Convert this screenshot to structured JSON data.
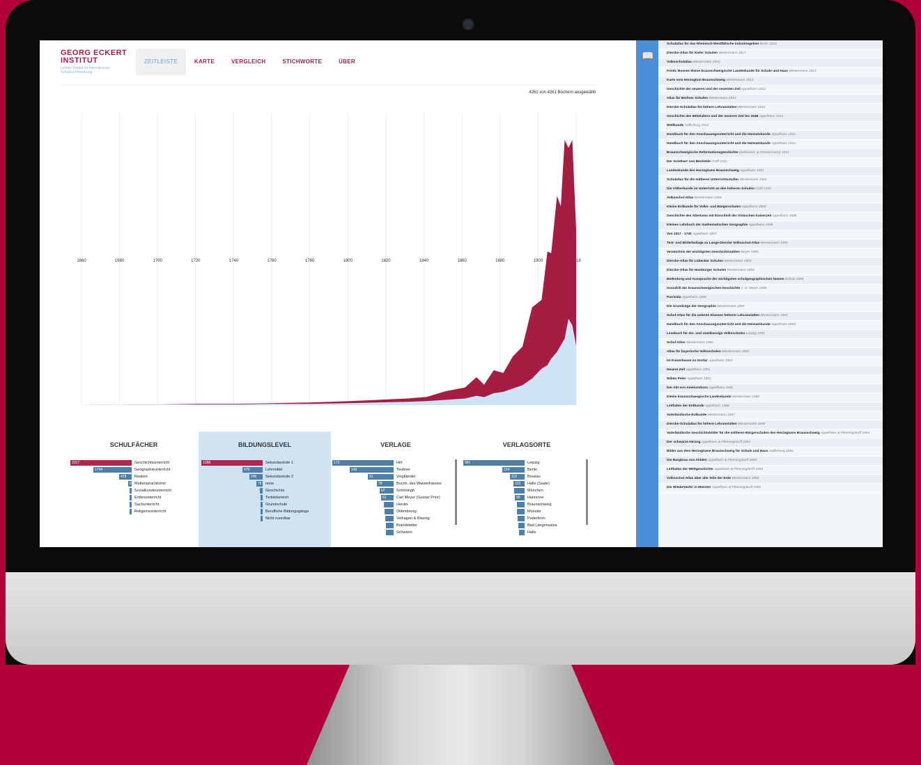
{
  "logo": {
    "line1": "GEORG ECKERT",
    "line2": "INSTITUT",
    "sub": "Leibniz-Institut für internationale Schulbuchforschung"
  },
  "nav": [
    {
      "label": "ZEITLEISTE",
      "active": true
    },
    {
      "label": "KARTE"
    },
    {
      "label": "VERGLEICH"
    },
    {
      "label": "STICHWORTE"
    },
    {
      "label": "ÜBER"
    }
  ],
  "count_text": "4261 von 4261 Büchern ausgewählt",
  "chart_data": {
    "type": "area",
    "x_ticks": [
      "1660",
      "1680",
      "1700",
      "1720",
      "1740",
      "1760",
      "1780",
      "1800",
      "1820",
      "1840",
      "1860",
      "1880",
      "1900",
      "1918"
    ],
    "colors": {
      "selected": "#a61d44",
      "total": "#cde4f5"
    },
    "series": [
      {
        "x": [
          1660,
          1700,
          1720,
          1740,
          1760,
          1780,
          1800,
          1815,
          1830,
          1840,
          1850,
          1860,
          1866,
          1870,
          1875,
          1880,
          1885,
          1890,
          1895,
          1900,
          1903,
          1905,
          1908,
          1910,
          1912,
          1914,
          1916,
          1918
        ],
        "y": [
          0,
          1,
          2,
          2,
          3,
          4,
          6,
          8,
          10,
          14,
          20,
          30,
          40,
          35,
          50,
          55,
          70,
          100,
          140,
          180,
          220,
          260,
          300,
          340,
          380,
          440,
          380,
          300
        ]
      },
      {
        "x": [
          1660,
          1700,
          1720,
          1740,
          1760,
          1780,
          1800,
          1815,
          1830,
          1840,
          1850,
          1860,
          1866,
          1870,
          1875,
          1880,
          1885,
          1890,
          1895,
          1900,
          1903,
          1905,
          1908,
          1910,
          1912,
          1914,
          1916,
          1918
        ],
        "y": [
          0,
          1,
          1,
          1,
          2,
          2,
          3,
          4,
          5,
          6,
          8,
          10,
          14,
          12,
          18,
          20,
          25,
          30,
          40,
          55,
          60,
          70,
          80,
          90,
          100,
          130,
          120,
          90
        ]
      }
    ]
  },
  "panels": {
    "schulfaecher": {
      "title": "SCHULFÄCHER",
      "rows": [
        {
          "value": "2317",
          "label": "Geschichtsunterricht",
          "color": "red",
          "frac": 1.0
        },
        {
          "value": "1744",
          "label": "Geographieunterricht",
          "color": "blue",
          "frac": 0.62
        },
        {
          "value": "478",
          "label": "Realien",
          "color": "blue",
          "frac": 0.2
        },
        {
          "value": "62",
          "label": "Muttersprachlicher",
          "color": "blue",
          "frac": 0.06
        },
        {
          "value": "",
          "label": "Sozialkundeunterricht",
          "color": "blue",
          "frac": 0.02
        },
        {
          "value": "",
          "label": "Erdlesunterricht",
          "color": "blue",
          "frac": 0.01
        },
        {
          "value": "",
          "label": "Sachunterricht",
          "color": "blue",
          "frac": 0.01
        },
        {
          "value": "",
          "label": "Religionsunterricht",
          "color": "blue",
          "frac": 0.01
        }
      ]
    },
    "bildungslevel": {
      "title": "BILDUNGSLEVEL",
      "rows": [
        {
          "value": "1288",
          "label": "Sekundarstufe 1",
          "color": "red",
          "frac": 1.0
        },
        {
          "value": "478",
          "label": "Lehrmittel",
          "color": "blue",
          "frac": 0.33
        },
        {
          "value": "296",
          "label": "Sekundarstufe 2",
          "color": "blue",
          "frac": 0.22
        },
        {
          "value": "76",
          "label": "none",
          "color": "blue",
          "frac": 0.1
        },
        {
          "value": "",
          "label": "Geschichte",
          "color": "blue",
          "frac": 0.04
        },
        {
          "value": "",
          "label": "Tertiärbereich",
          "color": "blue",
          "frac": 0.02
        },
        {
          "value": "",
          "label": "Grundschule",
          "color": "blue",
          "frac": 0.01
        },
        {
          "value": "",
          "label": "Berufliche Bildungsgänge",
          "color": "blue",
          "frac": 0.01
        },
        {
          "value": "",
          "label": "Nicht zuordbar",
          "color": "blue",
          "frac": 0.01
        }
      ]
    },
    "verlage": {
      "title": "VERLAGE",
      "rows": [
        {
          "value": "173",
          "label": "Hirt",
          "color": "blue",
          "frac": 1.0
        },
        {
          "value": "149",
          "label": "Teubner",
          "color": "blue",
          "frac": 0.72
        },
        {
          "value": "91",
          "label": "Voigtländer",
          "color": "blue",
          "frac": 0.42
        },
        {
          "value": "78",
          "label": "Buchh. des Waisenhauses",
          "color": "blue",
          "frac": 0.27
        },
        {
          "value": "67",
          "label": "Schöningh",
          "color": "blue",
          "frac": 0.23
        },
        {
          "value": "61",
          "label": "Carl Meyer (Gustav Prior)",
          "color": "blue",
          "frac": 0.2
        },
        {
          "value": "",
          "label": "Herder",
          "color": "blue",
          "frac": 0.16
        },
        {
          "value": "",
          "label": "Oldenbourg",
          "color": "blue",
          "frac": 0.15
        },
        {
          "value": "",
          "label": "Velhagen & Klasing",
          "color": "blue",
          "frac": 0.14
        },
        {
          "value": "",
          "label": "Brandstetter",
          "color": "blue",
          "frac": 0.13
        },
        {
          "value": "",
          "label": "Schwann",
          "color": "blue",
          "frac": 0.12
        }
      ]
    },
    "verlagsorte": {
      "title": "VERLAGSORTE",
      "rows": [
        {
          "value": "981",
          "label": "Leipzig",
          "color": "blue",
          "frac": 1.0
        },
        {
          "value": "224",
          "label": "Berlin",
          "color": "blue",
          "frac": 0.36
        },
        {
          "value": "118",
          "label": "Breslau",
          "color": "blue",
          "frac": 0.24
        },
        {
          "value": "102",
          "label": "Halle (Saale)",
          "color": "blue",
          "frac": 0.18
        },
        {
          "value": "",
          "label": "München",
          "color": "blue",
          "frac": 0.17
        },
        {
          "value": "95",
          "label": "Hannover",
          "color": "blue",
          "frac": 0.16
        },
        {
          "value": "",
          "label": "Braunschweig",
          "color": "blue",
          "frac": 0.13
        },
        {
          "value": "",
          "label": "Münster",
          "color": "blue",
          "frac": 0.12
        },
        {
          "value": "",
          "label": "Paderborn",
          "color": "blue",
          "frac": 0.11
        },
        {
          "value": "",
          "label": "Bad Langensalza",
          "color": "blue",
          "frac": 0.1
        },
        {
          "value": "",
          "label": "Halle",
          "color": "blue",
          "frac": 0.09
        }
      ]
    }
  },
  "book_list": [
    {
      "title": "Schulatlas für das Rheinisch-Westfälische Industriegebiet",
      "meta": "Berlin 1918"
    },
    {
      "title": "Diercke-Atlas für Kieler Schulen",
      "meta": "Westermann 1917"
    },
    {
      "title": "Volksschulatlas",
      "meta": "Westermann 1916"
    },
    {
      "title": "Friedr. Bosses kleine braunschweigische Landeskunde für Schule und Haus",
      "meta": "Westermann 1914"
    },
    {
      "title": "Karte vom Herzogtum Braunschweig",
      "meta": "Westermann 1914"
    },
    {
      "title": "Geschichte der neueren und der neuesten Zeit",
      "meta": "Appelhans 1913"
    },
    {
      "title": "Atlas für Berliner Schulen",
      "meta": "Westermann 1913"
    },
    {
      "title": "Diercke-Schulatlas für höhere Lehranstalten",
      "meta": "Westermann 1913"
    },
    {
      "title": "Geschichte des Mittelalters und der neueren Zeit bis 1648",
      "meta": "Appelhans 1912"
    },
    {
      "title": "Weltkunde",
      "meta": "Hafferburg 1912"
    },
    {
      "title": "Handbuch für den Anschauungsunterricht und die Heimatskunde",
      "meta": "Appelhans 1912"
    },
    {
      "title": "Handbuch für den Anschauungsunterricht und die Heimatskunde",
      "meta": "Appelhans 1912"
    },
    {
      "title": "Braunschweigische Reformationsgeschichte",
      "meta": "(Selbstverl. & Zimmermann) 1912"
    },
    {
      "title": "Der Schöherr von Bechelde",
      "meta": "Graff 1911"
    },
    {
      "title": "Landeskunde des Herzogtums Braunschweig",
      "meta": "Appelhans 1911"
    },
    {
      "title": "Schulatlas für die mittleren Unterrichtsstufen",
      "meta": "Westermann 1910"
    },
    {
      "title": "Die Völkerkunde im Unterricht an den höheren Schulen",
      "meta": "Graff 1910"
    },
    {
      "title": "Volksschul-Atlas",
      "meta": "Westermann 1909"
    },
    {
      "title": "Kleine Erdkunde für Volks- und Bürgerschulen",
      "meta": "Appelhans 1909"
    },
    {
      "title": "Geschichte des Altertums mit Einschluß der römischen Kaiserzeit",
      "meta": "Appelhans 1908"
    },
    {
      "title": "Kleines Lehrbuch der mathematischen Geographie",
      "meta": "Appelhans 1908"
    },
    {
      "title": "Von 1517 - 1740",
      "meta": "Appelhans 1907"
    },
    {
      "title": "Text- und Bilderbeilage zu Lange-Diercke Volksschul-Atlas",
      "meta": "Westermann 1906"
    },
    {
      "title": "Verzeichnis der wichtigsten Geschichtszahlen",
      "meta": "Meyer 1906"
    },
    {
      "title": "Diercke-Atlas für Lübecker Schulen",
      "meta": "Westermann 1905"
    },
    {
      "title": "Diercke-Atlas für Hamburger Schulen",
      "meta": "Westermann 1905"
    },
    {
      "title": "Bedeutung und Aussprache der wichtigsten schulgeographischen Namen",
      "meta": "Scholz 1905"
    },
    {
      "title": "Grundriß der braunschweigischen Geschichte",
      "meta": "J. H. Meyer 1905"
    },
    {
      "title": "Parrisida",
      "meta": "Appelhans 1905"
    },
    {
      "title": "Die Grundzüge der Geographie",
      "meta": "Westermann 1904"
    },
    {
      "title": "Schul-Atlas für die unteren Klassen höherer Lehranstalten",
      "meta": "Westermann 1903"
    },
    {
      "title": "Handbuch für den Anschauungsunterricht und die Heimatskunde",
      "meta": "Appelhans 1903"
    },
    {
      "title": "Lesebuch für ein- und zweiklassige Volksschulen",
      "meta": "Leipzig 1902"
    },
    {
      "title": "Schul-Atlas",
      "meta": "Westermann 1902"
    },
    {
      "title": "Atlas für bayerische Volksschulen",
      "meta": "Westermann 1902"
    },
    {
      "title": "Im Kaiserhause zu Goslar",
      "meta": "Appelhans 1902"
    },
    {
      "title": "Neuere Zeit",
      "meta": "Appelhans 1901"
    },
    {
      "title": "Wiben Peter",
      "meta": "Appelhans 1901"
    },
    {
      "title": "Der Abt von Amelunxborn",
      "meta": "Appelhans 1900"
    },
    {
      "title": "Kleine braunschweigische Landeskunde",
      "meta": "Westermann 1898"
    },
    {
      "title": "Leitfaden der Erdkunde",
      "meta": "Appelhans 1898"
    },
    {
      "title": "Vaterländische Erdkunde",
      "meta": "Westermann 1897"
    },
    {
      "title": "Diercke-Schulatlas für höhere Lehranstalten",
      "meta": "Westermann 1895"
    },
    {
      "title": "Vaterländische Geschichtsbilder für die mittleren Bürgerschulen des Herzogtums Braunschweig",
      "meta": "Appelhans & Pfenningstorff 1894"
    },
    {
      "title": "Der schwarze Herzog",
      "meta": "Appelhans & Pfenningstorff 1894"
    },
    {
      "title": "Bilder aus dem Herzogtume Braunschweig für Schule und Haus",
      "meta": "Hafferburg 1894"
    },
    {
      "title": "Die Burgbrau von Ahlden",
      "meta": "Appelhans & Pfenningstorff 1893"
    },
    {
      "title": "Leitfaden der Weltgeschichte",
      "meta": "Appelhans & Pfenningstorff 1893"
    },
    {
      "title": "Volksschul-Atlas über alle Teile der Erde",
      "meta": "Westermann 1892"
    },
    {
      "title": "Die Wiedertäufer in Münster",
      "meta": "Appelhans & Pfenningstorff 1892"
    }
  ]
}
